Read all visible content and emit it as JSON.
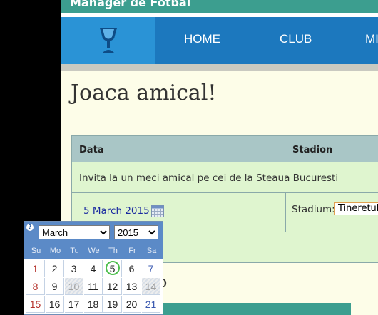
{
  "header": {
    "brand": "Manager de Fotbal",
    "nav": [
      "HOME",
      "CLUB",
      "MI"
    ]
  },
  "page": {
    "title": "Joaca amical!",
    "table": {
      "headers": [
        "Data",
        "Stadion"
      ],
      "invite_text": "Invita la un meci amical pe cei de la Steaua Bucuresti",
      "date_value": "5 March 2015",
      "stadium_label": "Stadium:",
      "stadium_value": "Tineretului"
    },
    "sub_heading": "o"
  },
  "calendar": {
    "month": "March",
    "year": "2015",
    "weekdays": [
      "Su",
      "Mo",
      "Tu",
      "We",
      "Th",
      "Fr",
      "Sa"
    ],
    "weeks": [
      [
        "1",
        "2",
        "3",
        "4",
        "5",
        "6",
        "7"
      ],
      [
        "8",
        "9",
        "10",
        "11",
        "12",
        "13",
        "14"
      ],
      [
        "15",
        "16",
        "17",
        "18",
        "19",
        "20",
        "21"
      ]
    ],
    "today": "5",
    "disabled": [
      "10",
      "14"
    ]
  },
  "colors": {
    "header_teal": "#3c9e8f",
    "nav_blue": "#1c78be",
    "row_green": "#dff5cf",
    "calendar_blue": "#5b8ac7"
  }
}
